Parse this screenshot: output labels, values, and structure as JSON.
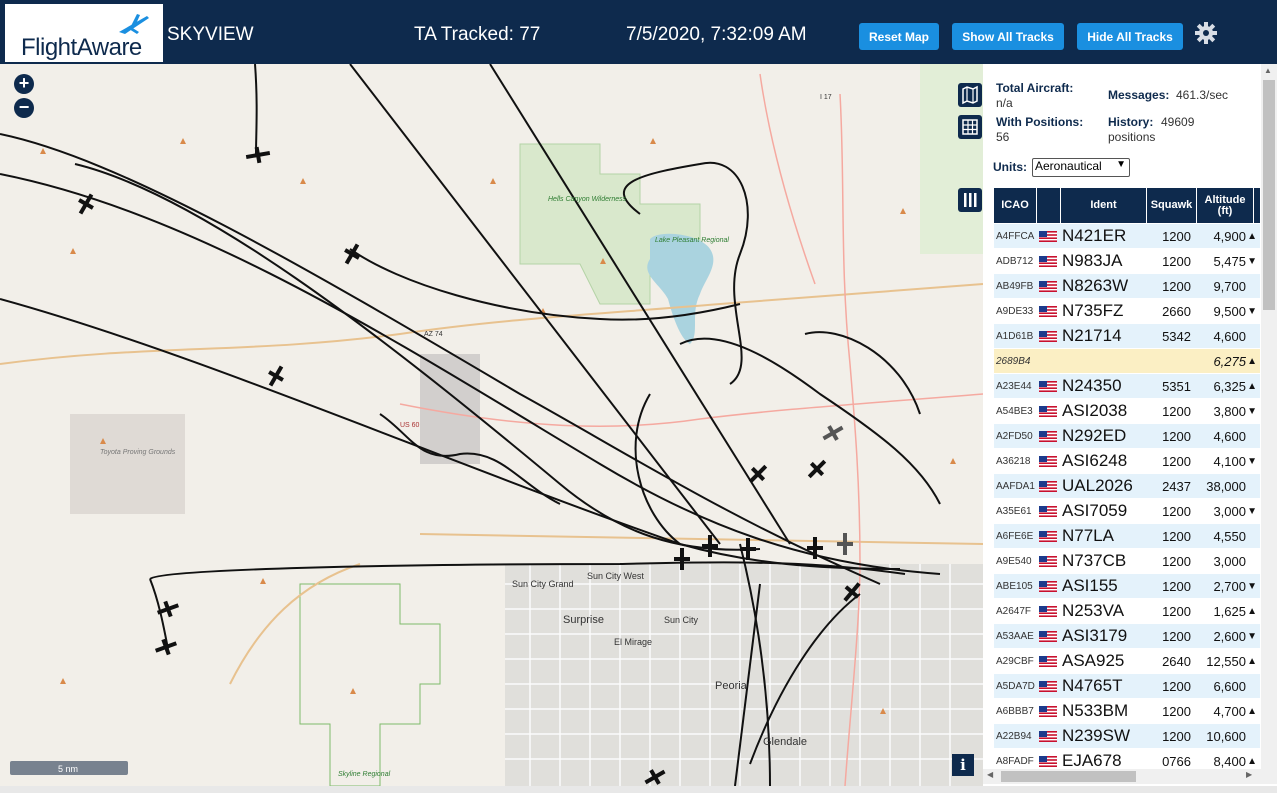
{
  "header": {
    "logo_text": "FlightAware",
    "title": "SKYVIEW",
    "tracked": "TA Tracked: 77",
    "datetime": "7/5/2020, 7:32:09 AM",
    "buttons": {
      "reset": "Reset Map",
      "show_all": "Show All Tracks",
      "hide_all": "Hide All Tracks"
    },
    "brand_color": "#0e2a4d",
    "button_color": "#1a8fe0"
  },
  "map": {
    "zoom_in": "+",
    "zoom_out": "−",
    "scale_label": "5 nm",
    "info_label": "i",
    "labels": {
      "hells_canyon": "Hells Canyon Wilderness",
      "lake": "Lake Pleasant Regional",
      "toyota": "Toyota Proving Grounds",
      "sun_city_grand": "Sun City Grand",
      "sun_city_west": "Sun City West",
      "surprise": "Surprise",
      "sun_city": "Sun City",
      "el_mirage": "El Mirage",
      "peoria": "Peoria",
      "glendale": "Glendale",
      "skyline": "Skyline Regional",
      "az74": "AZ 74",
      "us60": "US 60",
      "i17": "I 17"
    }
  },
  "panel": {
    "total_aircraft_label": "Total Aircraft:",
    "total_aircraft_value": "n/a",
    "with_positions_label": "With Positions:",
    "with_positions_value": "56",
    "messages_label": "Messages:",
    "messages_value": "461.3/sec",
    "history_label": "History:",
    "history_value": "49609 positions",
    "units_label": "Units:",
    "units_value": "Aeronautical",
    "columns": {
      "icao": "ICAO",
      "ident": "Ident",
      "squawk": "Squawk",
      "altitude": "Altitude (ft)"
    },
    "rows": [
      {
        "icao": "A4FFCA",
        "ident": "N421ER",
        "squawk": "1200",
        "alt": "4,900",
        "trend": "▲"
      },
      {
        "icao": "ADB712",
        "ident": "N983JA",
        "squawk": "1200",
        "alt": "5,475",
        "trend": "▼"
      },
      {
        "icao": "AB49FB",
        "ident": "N8263W",
        "squawk": "1200",
        "alt": "9,700",
        "trend": ""
      },
      {
        "icao": "A9DE33",
        "ident": "N735FZ",
        "squawk": "2660",
        "alt": "9,500",
        "trend": "▼"
      },
      {
        "icao": "A1D61B",
        "ident": "N21714",
        "squawk": "5342",
        "alt": "4,600",
        "trend": ""
      },
      {
        "icao": "2689B4",
        "ident": "",
        "squawk": "",
        "alt": "6,275",
        "trend": "▲"
      },
      {
        "icao": "A23E44",
        "ident": "N24350",
        "squawk": "5351",
        "alt": "6,325",
        "trend": "▲"
      },
      {
        "icao": "A54BE3",
        "ident": "ASI2038",
        "squawk": "1200",
        "alt": "3,800",
        "trend": "▼"
      },
      {
        "icao": "A2FD50",
        "ident": "N292ED",
        "squawk": "1200",
        "alt": "4,600",
        "trend": ""
      },
      {
        "icao": "A36218",
        "ident": "ASI6248",
        "squawk": "1200",
        "alt": "4,100",
        "trend": "▼"
      },
      {
        "icao": "AAFDA1",
        "ident": "UAL2026",
        "squawk": "2437",
        "alt": "38,000",
        "trend": ""
      },
      {
        "icao": "A35E61",
        "ident": "ASI7059",
        "squawk": "1200",
        "alt": "3,000",
        "trend": "▼"
      },
      {
        "icao": "A6FE6E",
        "ident": "N77LA",
        "squawk": "1200",
        "alt": "4,550",
        "trend": ""
      },
      {
        "icao": "A9E540",
        "ident": "N737CB",
        "squawk": "1200",
        "alt": "3,000",
        "trend": ""
      },
      {
        "icao": "ABE105",
        "ident": "ASI155",
        "squawk": "1200",
        "alt": "2,700",
        "trend": "▼"
      },
      {
        "icao": "A2647F",
        "ident": "N253VA",
        "squawk": "1200",
        "alt": "1,625",
        "trend": "▲"
      },
      {
        "icao": "A53AAE",
        "ident": "ASI3179",
        "squawk": "1200",
        "alt": "2,600",
        "trend": "▼"
      },
      {
        "icao": "A29CBF",
        "ident": "ASA925",
        "squawk": "2640",
        "alt": "12,550",
        "trend": "▲"
      },
      {
        "icao": "A5DA7D",
        "ident": "N4765T",
        "squawk": "1200",
        "alt": "6,600",
        "trend": ""
      },
      {
        "icao": "A6BBB7",
        "ident": "N533BM",
        "squawk": "1200",
        "alt": "4,700",
        "trend": "▲"
      },
      {
        "icao": "A22B94",
        "ident": "N239SW",
        "squawk": "1200",
        "alt": "10,600",
        "trend": ""
      },
      {
        "icao": "A8FADF",
        "ident": "EJA678",
        "squawk": "0766",
        "alt": "8,400",
        "trend": "▲"
      }
    ],
    "row_color_even": "#e4f2fb",
    "row_color_odd": "#ffffff",
    "row_color_highlight": "#fbefc4"
  }
}
